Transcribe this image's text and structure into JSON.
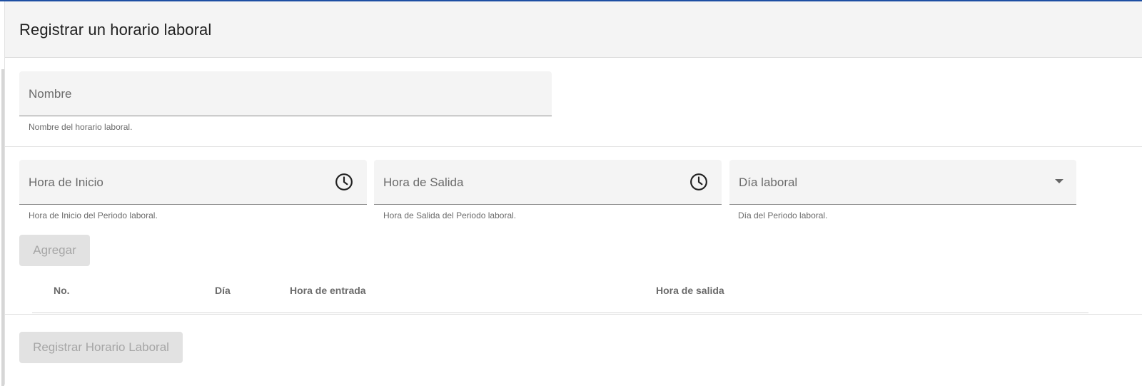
{
  "header": {
    "title": "Registrar un horario laboral"
  },
  "form": {
    "nombre": {
      "label": "Nombre",
      "hint": "Nombre del horario laboral."
    },
    "hora_inicio": {
      "label": "Hora de Inicio",
      "hint": "Hora de Inicio del Periodo laboral.",
      "icon": "clock-icon"
    },
    "hora_salida": {
      "label": "Hora de Salida",
      "hint": "Hora de Salida del Periodo laboral.",
      "icon": "clock-icon"
    },
    "dia_laboral": {
      "label": "Día laboral",
      "hint": "Día del Periodo laboral.",
      "icon": "chevron-down-icon"
    },
    "agregar_label": "Agregar"
  },
  "table": {
    "columns": [
      "No.",
      "Día",
      "Hora de entrada",
      "Hora de salida"
    ]
  },
  "footer": {
    "submit_label": "Registrar Horario Laboral"
  },
  "colors": {
    "accent_top_line": "#1e4fa3",
    "field_background": "#f4f4f4",
    "disabled_button": "#e2e2e2",
    "disabled_text": "#a6a6a6"
  }
}
